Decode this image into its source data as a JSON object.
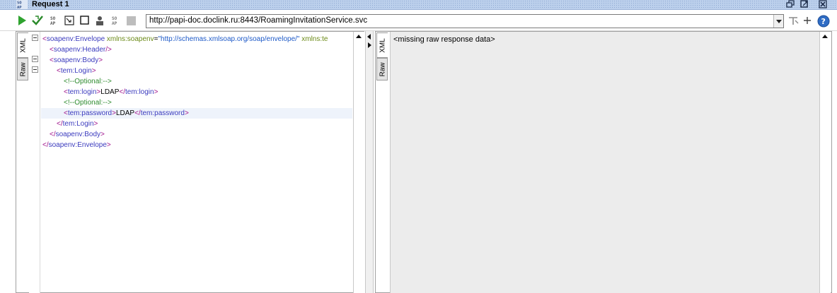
{
  "window": {
    "title": "Request 1",
    "title_icon_text": "SO AP",
    "buttons": [
      "restore",
      "maximize",
      "close"
    ]
  },
  "toolbar": {
    "icons": [
      "run-icon",
      "validate-icon",
      "soap-icon",
      "format-icon",
      "stop-icon",
      "user-icon",
      "soap2-icon",
      "cancel-icon"
    ],
    "url": "http://papi-doc.doclink.ru:8443/RoamingInvitationService.svc",
    "right_icons": [
      "endpoint-icon",
      "add-icon",
      "help-icon"
    ]
  },
  "left_editor": {
    "tabs": [
      "XML",
      "Raw"
    ],
    "lines": [
      {
        "indent": 0,
        "parts": [
          [
            "tag",
            "<"
          ],
          [
            "name",
            "soapenv:Envelope"
          ],
          [
            "attr",
            " xmlns:soapenv"
          ],
          [
            "txt",
            "="
          ],
          [
            "val",
            "\"http://schemas.xmlsoap.org/soap/envelope/\""
          ],
          [
            "attr",
            " xmlns:te"
          ]
        ]
      },
      {
        "indent": 1,
        "parts": [
          [
            "tag",
            "<"
          ],
          [
            "name",
            "soapenv:Header"
          ],
          [
            "tag",
            "/>"
          ]
        ]
      },
      {
        "indent": 1,
        "parts": [
          [
            "tag",
            "<"
          ],
          [
            "name",
            "soapenv:Body"
          ],
          [
            "tag",
            ">"
          ]
        ]
      },
      {
        "indent": 2,
        "parts": [
          [
            "tag",
            "<"
          ],
          [
            "name",
            "tem:Login"
          ],
          [
            "tag",
            ">"
          ]
        ]
      },
      {
        "indent": 3,
        "parts": [
          [
            "com",
            "<!--Optional:-->"
          ]
        ]
      },
      {
        "indent": 3,
        "parts": [
          [
            "tag",
            "<"
          ],
          [
            "name",
            "tem:login"
          ],
          [
            "tag",
            ">"
          ],
          [
            "txt",
            "LDAP"
          ],
          [
            "tag",
            "</"
          ],
          [
            "name",
            "tem:login"
          ],
          [
            "tag",
            ">"
          ]
        ]
      },
      {
        "indent": 3,
        "parts": [
          [
            "com",
            "<!--Optional:-->"
          ]
        ]
      },
      {
        "indent": 3,
        "parts": [
          [
            "tag",
            "<"
          ],
          [
            "name",
            "tem:password"
          ],
          [
            "tag",
            ">"
          ],
          [
            "txt",
            "LDAP"
          ],
          [
            "tag",
            "</"
          ],
          [
            "name",
            "tem:password"
          ],
          [
            "tag",
            ">"
          ]
        ]
      },
      {
        "indent": 2,
        "parts": [
          [
            "tag",
            "</"
          ],
          [
            "name",
            "tem:Login"
          ],
          [
            "tag",
            ">"
          ]
        ]
      },
      {
        "indent": 1,
        "parts": [
          [
            "tag",
            "</"
          ],
          [
            "name",
            "soapenv:Body"
          ],
          [
            "tag",
            ">"
          ]
        ]
      },
      {
        "indent": 0,
        "parts": [
          [
            "tag",
            "</"
          ],
          [
            "name",
            "soapenv:Envelope"
          ],
          [
            "tag",
            ">"
          ]
        ]
      }
    ],
    "highlighted_line": 8
  },
  "right_editor": {
    "tabs": [
      "XML",
      "Raw"
    ],
    "message": "<missing raw response data>"
  }
}
